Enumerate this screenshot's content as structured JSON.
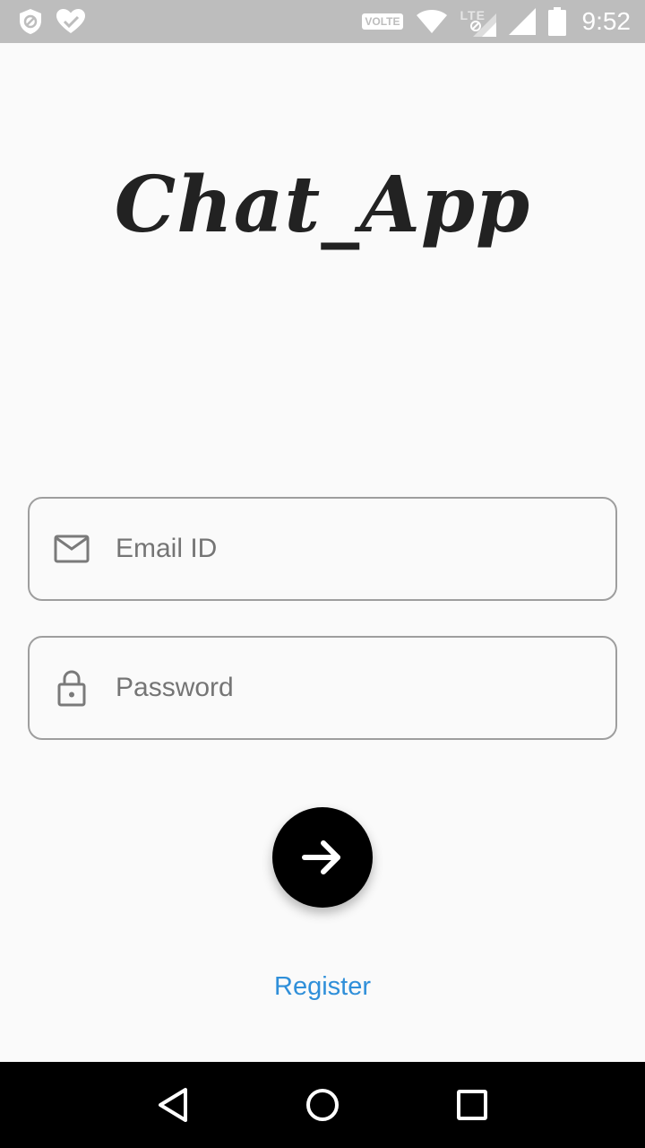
{
  "status_bar": {
    "volte": "VOLTE",
    "lte": "LTE",
    "time": "9:52",
    "icons": [
      "shield-blocked-icon",
      "heart-check-icon",
      "volte-badge",
      "wifi-icon",
      "lte-icon",
      "signal-icon",
      "signal-icon",
      "battery-icon"
    ]
  },
  "app": {
    "title": "Chat_App"
  },
  "form": {
    "email": {
      "value": "",
      "placeholder": "Email ID",
      "icon": "mail-icon"
    },
    "password": {
      "value": "",
      "placeholder": "Password",
      "icon": "lock-icon"
    },
    "submit_icon": "arrow-right-icon"
  },
  "register": {
    "label": "Register"
  },
  "nav": {
    "back_icon": "back-triangle-icon",
    "home_icon": "home-circle-icon",
    "recents_icon": "recents-square-icon"
  },
  "colors": {
    "status_bar": "#bdbdbd",
    "background": "#fafafa",
    "accent_link": "#2f8fd9",
    "button": "#000000",
    "field_border": "#9e9e9e"
  }
}
